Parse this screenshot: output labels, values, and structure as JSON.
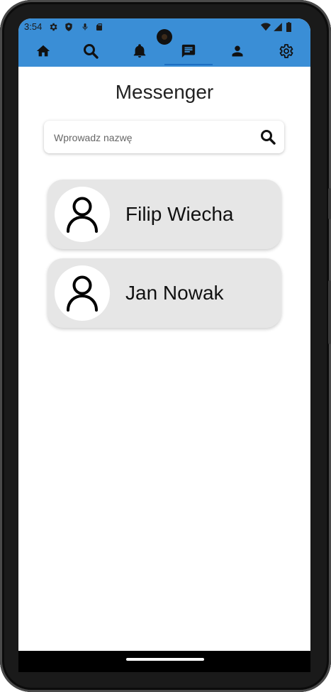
{
  "status_bar": {
    "time": "3:54",
    "icons_left": [
      "gear-icon",
      "shield-icon",
      "mic-icon",
      "sd-card-icon"
    ],
    "icons_right": [
      "wifi-icon",
      "signal-icon",
      "battery-icon"
    ]
  },
  "nav": {
    "items": [
      {
        "name": "home-icon"
      },
      {
        "name": "search-icon"
      },
      {
        "name": "bell-icon"
      },
      {
        "name": "chat-icon",
        "active": true
      },
      {
        "name": "person-icon"
      },
      {
        "name": "settings-icon"
      }
    ],
    "background": "#3a8ed6",
    "active_color": "#1e6fc2"
  },
  "page": {
    "title": "Messenger"
  },
  "search": {
    "placeholder": "Wprowadz nazwę",
    "value": ""
  },
  "contacts": [
    {
      "name": "Filip Wiecha",
      "avatar": "person-outline-icon"
    },
    {
      "name": "Jan Nowak",
      "avatar": "person-outline-icon"
    }
  ]
}
